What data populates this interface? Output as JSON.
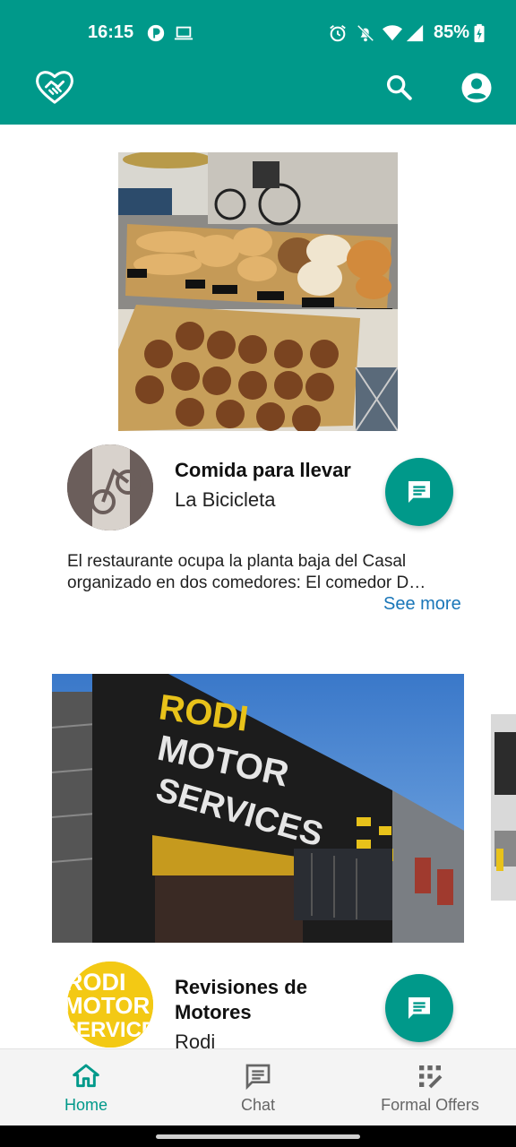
{
  "status_bar": {
    "time": "16:15",
    "battery": "85%",
    "icons": [
      "profile-status-icon",
      "laptop-icon",
      "alarm-icon",
      "notifications-off-icon",
      "wifi-icon",
      "signal-icon",
      "battery-charging-icon"
    ]
  },
  "app_bar": {
    "logo_icon": "heart-handshake-icon",
    "actions": [
      "search-icon",
      "account-circle-icon"
    ]
  },
  "listings": [
    {
      "title": "Comida para llevar",
      "business": "La Bicicleta",
      "description_line1": "El restaurante ocupa la planta baja del Casal",
      "description_line2": "organizado en dos comedores: El comedor D…",
      "see_more": "See more"
    },
    {
      "title_line1": "Revisiones de",
      "title_line2": "Motores",
      "business": "Rodi",
      "sign_line1": "RODI",
      "sign_line2": "MOTOR",
      "sign_line3": "SERVICES",
      "avatar_line1": "RODI",
      "avatar_line2": "MOTOR",
      "avatar_line3": "SERVICE"
    }
  ],
  "bottom_nav": {
    "home": "Home",
    "chat": "Chat",
    "offers": "Formal Offers",
    "active": "home"
  },
  "colors": {
    "primary": "#00998a",
    "link": "#1976b8",
    "nav_inactive": "#666666"
  }
}
